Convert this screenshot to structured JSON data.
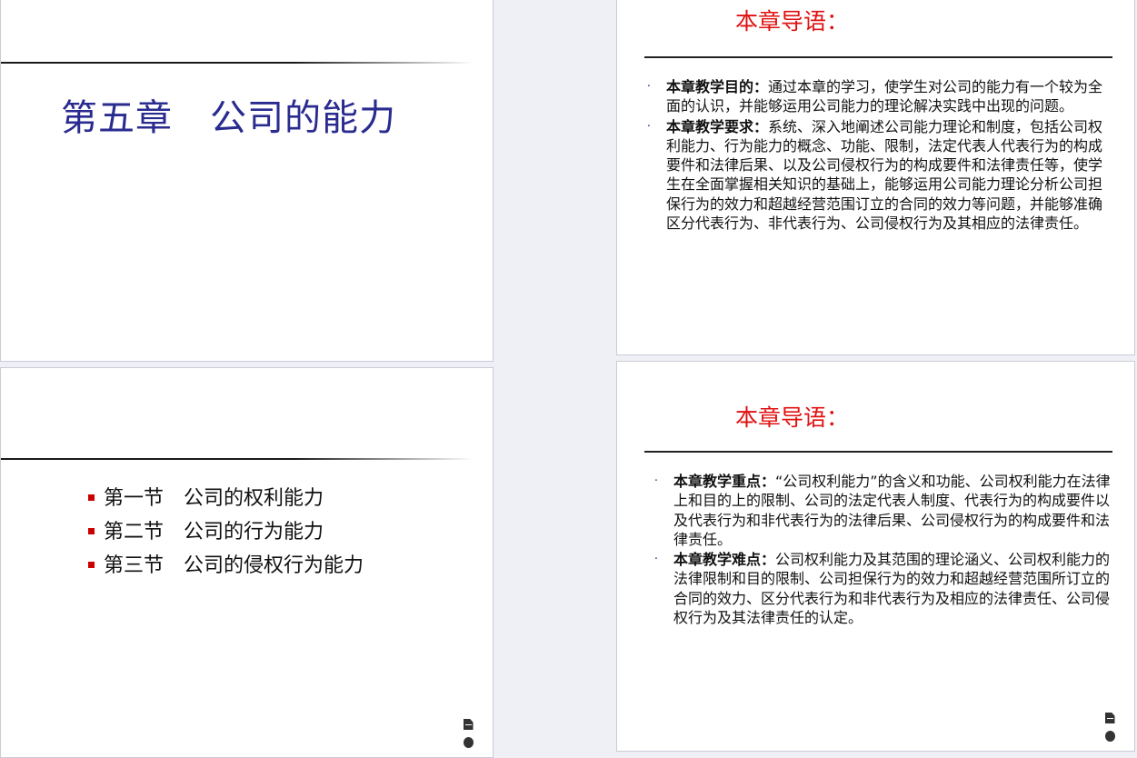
{
  "slides": {
    "title_slide": {
      "title": "第五章　公司的能力"
    },
    "toc_slide": {
      "items": [
        {
          "label": "第一节　公司的权利能力"
        },
        {
          "label": "第二节　公司的行为能力"
        },
        {
          "label": "第三节　公司的侵权行为能力"
        }
      ]
    },
    "intro_slide_1": {
      "heading": "本章导语：",
      "points": [
        {
          "label": "本章教学目的：",
          "text": "通过本章的学习，使学生对公司的能力有一个较为全面的认识，并能够运用公司能力的理论解决实践中出现的问题。"
        },
        {
          "label": "本章教学要求：",
          "text": "系统、深入地阐述公司能力理论和制度，包括公司权利能力、行为能力的概念、功能、限制，法定代表人代表行为的构成要件和法律后果、以及公司侵权行为的构成要件和法律责任等，使学生在全面掌握相关知识的基础上，能够运用公司能力理论分析公司担保行为的效力和超越经营范围订立的合同的效力等问题，并能够准确区分代表行为、非代表行为、公司侵权行为及其相应的法律责任。"
        }
      ]
    },
    "intro_slide_2": {
      "heading": "本章导语：",
      "points": [
        {
          "label": "本章教学重点：",
          "text": "“公司权利能力”的含义和功能、公司权利能力在法律上和目的上的限制、公司的法定代表人制度、代表行为的构成要件以及代表行为和非代表行为的法律后果、公司侵权行为的构成要件和法律责任。"
        },
        {
          "label": "本章教学难点：",
          "text": "公司权利能力及其范围的理论涵义、公司权利能力的法律限制和目的限制、公司担保行为的效力和超越经营范围所订立的合同的效力、区分代表行为和非代表行为及相应的法律责任、公司侵权行为及其法律责任的认定。"
        }
      ]
    }
  },
  "colors": {
    "title_blue": "#2a2b8f",
    "heading_red": "#e01010",
    "bullet_red": "#cc0000"
  },
  "icons": [
    "document-icon",
    "disc-icon"
  ]
}
